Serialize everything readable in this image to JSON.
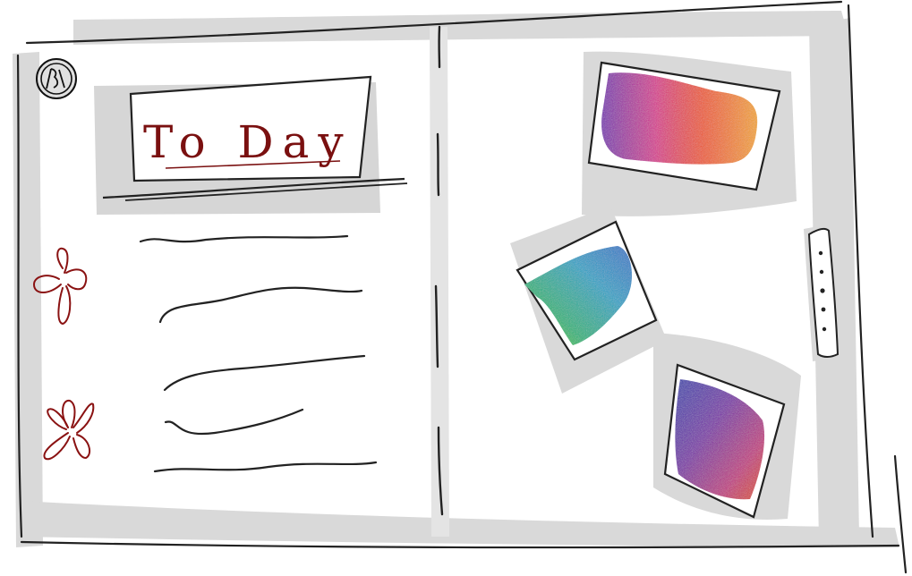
{
  "header": {
    "title": "To Day",
    "logo_icon": "badge-logo-icon"
  },
  "left_page": {
    "item_count": 5,
    "decorations": [
      "flower-icon",
      "flower-icon"
    ]
  },
  "right_page": {
    "photos": [
      {
        "name": "photo-rainbow-warm",
        "colors": [
          "#7a2bb3",
          "#d9338f",
          "#f0582c",
          "#f5a623"
        ]
      },
      {
        "name": "photo-rainbow-cool",
        "colors": [
          "#7fd11f",
          "#19b37a",
          "#1fa3c7",
          "#2c74c9"
        ]
      },
      {
        "name": "photo-rainbow-violet",
        "colors": [
          "#3a3fb0",
          "#7a2ba8",
          "#c22f7f",
          "#e04a20"
        ]
      }
    ],
    "scroll_handle_icon": "vertical-dots-icon"
  },
  "colors": {
    "ink": "#222222",
    "shadow": "#d6d6d6",
    "flower": "#8a1212",
    "title": "#7a1010"
  }
}
